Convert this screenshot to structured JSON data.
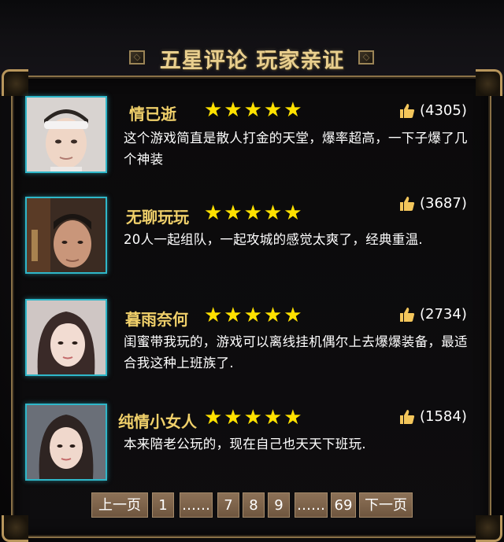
{
  "header": {
    "title": "五星评论 玩家亲证"
  },
  "reviews": [
    {
      "name": "情已逝",
      "stars": "★★★★★",
      "likes": "(4305)",
      "comment": "这个游戏简直是散人打金的天堂，爆率超高，一下子爆了几个神装"
    },
    {
      "name": "无聊玩玩",
      "stars": "★★★★★",
      "likes": "(3687)",
      "comment": "20人一起组队，一起攻城的感觉太爽了，经典重温."
    },
    {
      "name": "暮雨奈何",
      "stars": "★★★★★",
      "likes": "(2734)",
      "comment": "闺蜜带我玩的，游戏可以离线挂机偶尔上去爆爆装备，最适合我这种上班族了."
    },
    {
      "name": "纯情小女人",
      "stars": "★★★★★",
      "likes": "(1584)",
      "comment": "本来陪老公玩的，现在自己也天天下班玩."
    }
  ],
  "pager": {
    "prev": "上一页",
    "p1": "1",
    "ellipsis1": "……",
    "p7": "7",
    "p8": "8",
    "p9": "9",
    "ellipsis2": "……",
    "p69": "69",
    "next": "下一页"
  },
  "icons": {
    "title_ornament": "diamond-ornament-icon",
    "like": "thumbs-up-icon",
    "star": "star-icon"
  },
  "colors": {
    "title": "#e9cf8e",
    "name": "#f0d06a",
    "star": "#ffe100",
    "avatar_border": "#2fb7c9",
    "frame_border": "#8a7147",
    "pager_button": "#7d6249",
    "thumb": "#f3c65b"
  }
}
